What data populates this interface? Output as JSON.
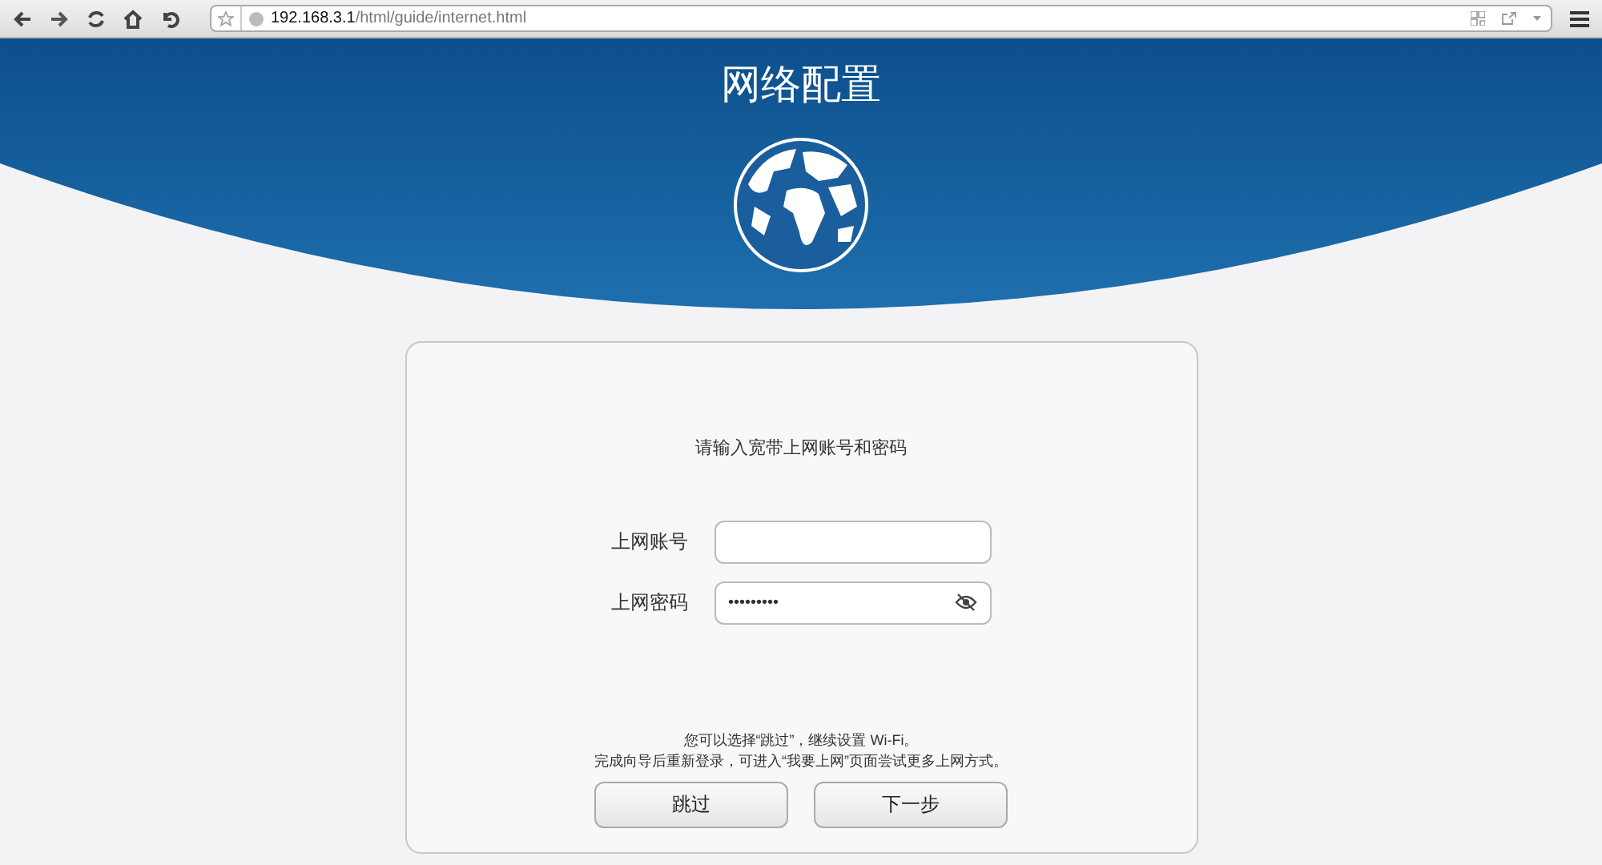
{
  "browser": {
    "url_host": "192.168.3.1",
    "url_path": "/html/guide/internet.html"
  },
  "header": {
    "title": "网络配置"
  },
  "form": {
    "prompt": "请输入宽带上网账号和密码",
    "fields": [
      {
        "kind": "text",
        "label": "上网账号"
      },
      {
        "kind": "password",
        "label": "上网密码",
        "value": "•••••••••"
      }
    ],
    "hint_lines": [
      "您可以选择“跳过”，继续设置 Wi-Fi。",
      "完成向导后重新登录，可进入“我要上网”页面尝试更多上网方式。"
    ],
    "buttons": [
      "跳过",
      "下一步"
    ]
  }
}
